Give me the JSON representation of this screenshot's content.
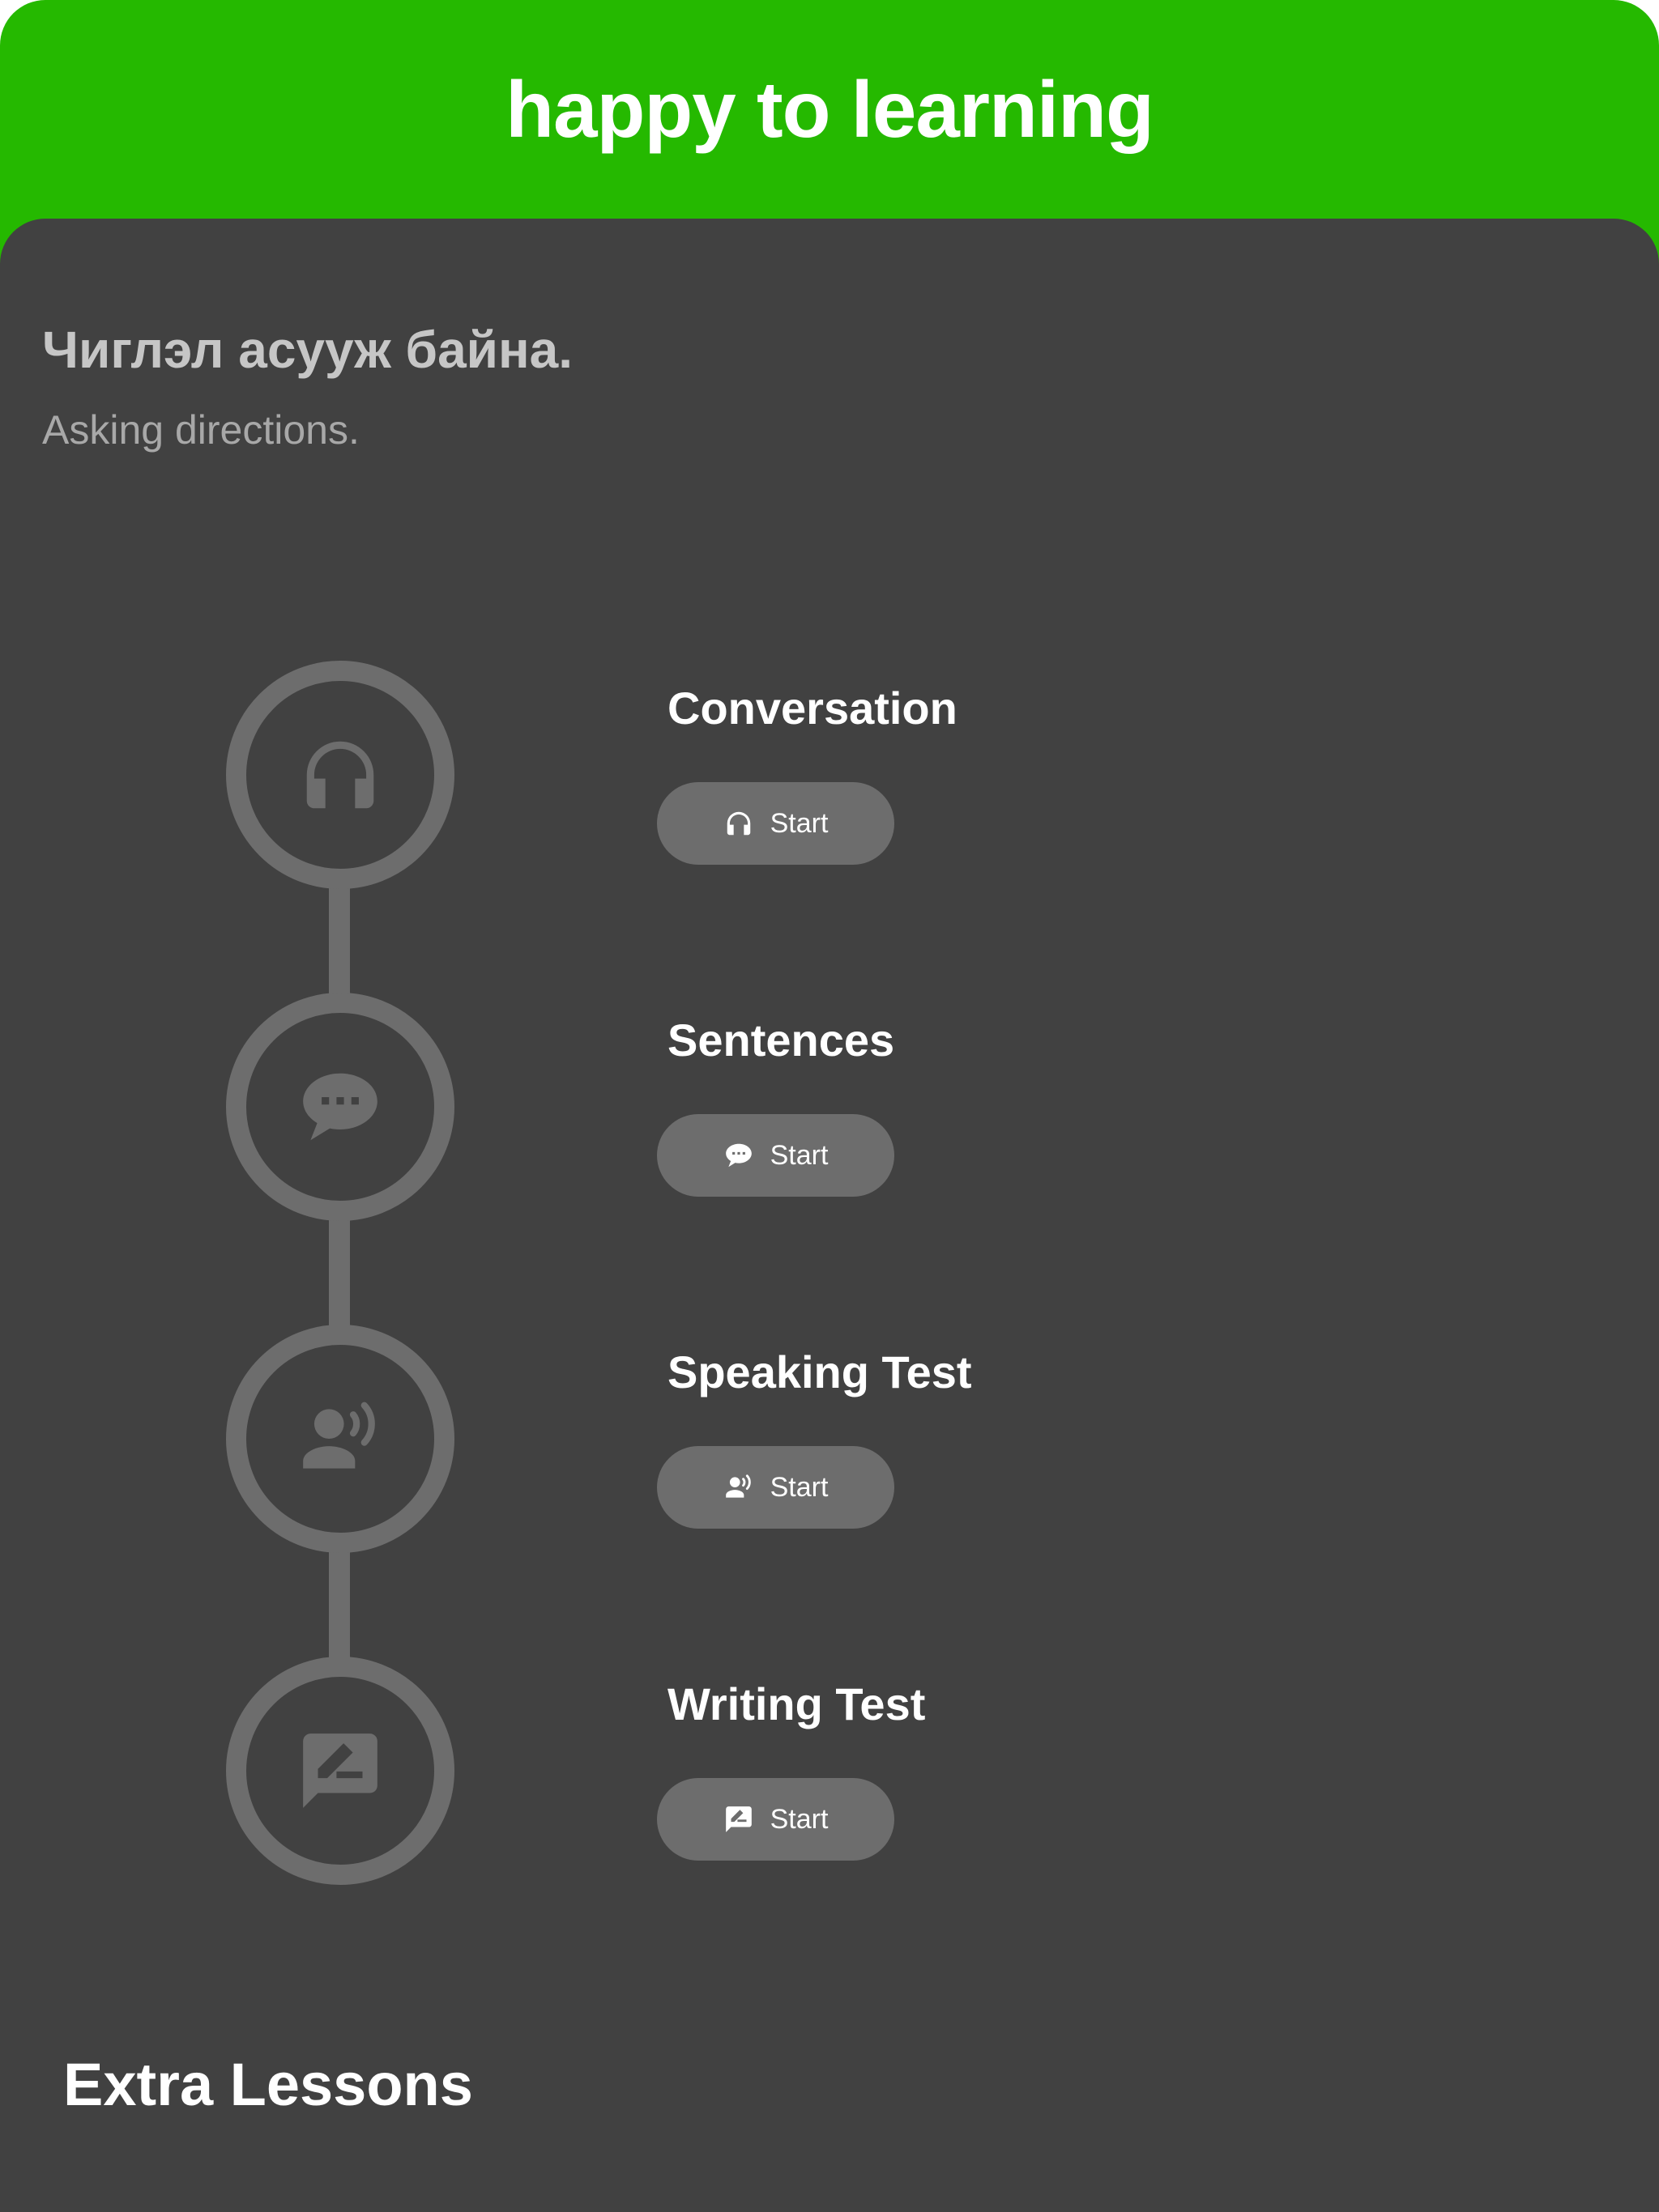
{
  "app": {
    "title": "happy to learning",
    "accent_color": "#25b900",
    "background_color": "#414141"
  },
  "lesson": {
    "title": "Чиглэл асууж байна.",
    "subtitle": "Asking directions."
  },
  "steps": [
    {
      "title": "Conversation",
      "icon": "headphones-icon",
      "button_label": "Start"
    },
    {
      "title": "Sentences",
      "icon": "chat-bubble-icon",
      "button_label": "Start"
    },
    {
      "title": "Speaking Test",
      "icon": "speaking-person-icon",
      "button_label": "Start"
    },
    {
      "title": "Writing Test",
      "icon": "edit-message-icon",
      "button_label": "Start"
    }
  ],
  "extra": {
    "title": "Extra Lessons"
  }
}
